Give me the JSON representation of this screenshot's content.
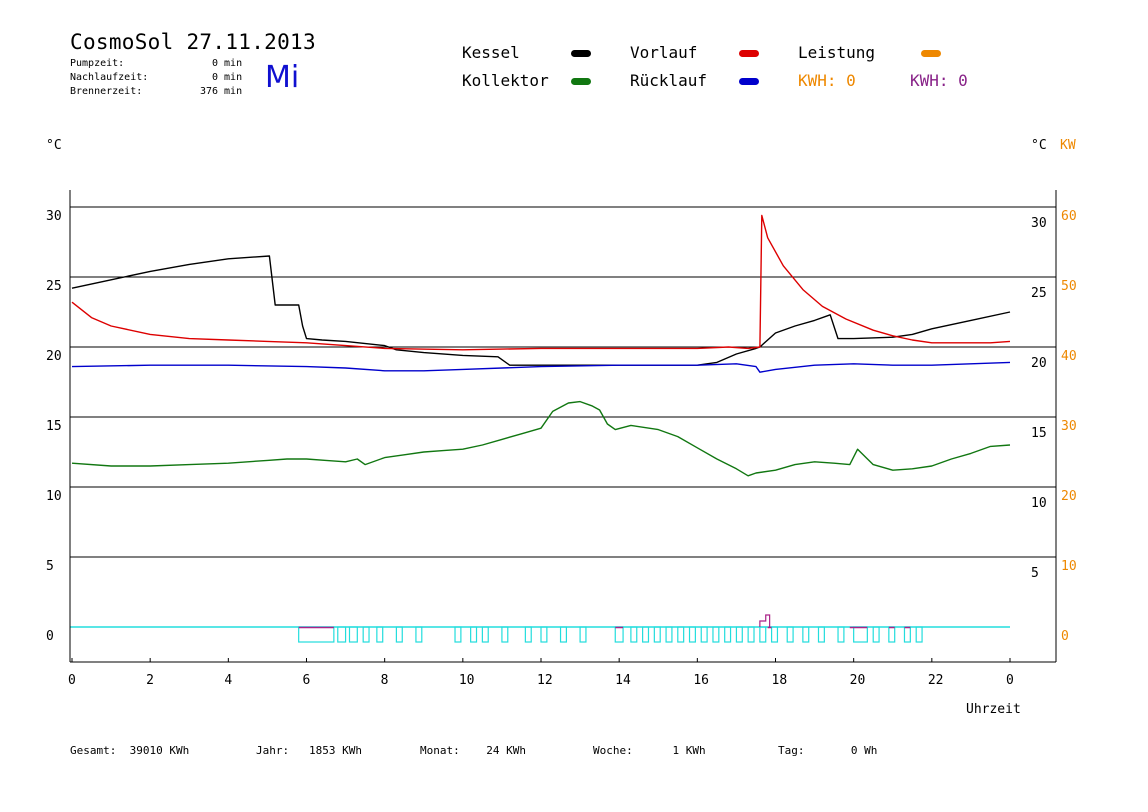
{
  "header": {
    "title": "CosmoSol 27.11.2013",
    "weekday": "Mi",
    "stats": [
      {
        "label": "Pumpzeit:",
        "value": "0",
        "unit": "min"
      },
      {
        "label": "Nachlaufzeit:",
        "value": "0",
        "unit": "min"
      },
      {
        "label": "Brennerzeit:",
        "value": "376",
        "unit": "min"
      }
    ]
  },
  "legend": {
    "kessel": "Kessel",
    "kollektor": "Kollektor",
    "vorlauf": "Vorlauf",
    "ruecklauf": "Rücklauf",
    "leistung": "Leistung",
    "kwh_orange": "KWH: 0",
    "kwh_purple": "KWH: 0"
  },
  "axes": {
    "left_unit": "°C",
    "right_unit": "°C",
    "right_unit2": "KW",
    "x_label": "Uhrzeit"
  },
  "colors": {
    "kessel": "#000000",
    "vorlauf": "#dd0000",
    "ruecklauf": "#0000cc",
    "kollektor": "#117711",
    "leistung": "#ee8800",
    "kwh_purple": "#882288",
    "pump": "#22dddd",
    "brenner": "#aa2288",
    "grid": "#000000"
  },
  "footer": [
    {
      "label": "Gesamt:",
      "value": "39010 KWh"
    },
    {
      "label": "Jahr:",
      "value": "1853 KWh"
    },
    {
      "label": "Monat:",
      "value": "24 KWh"
    },
    {
      "label": "Woche:",
      "value": "1 KWh"
    },
    {
      "label": "Tag:",
      "value": "0 Wh"
    }
  ],
  "chart_data": {
    "type": "line",
    "xlabel": "Uhrzeit",
    "x_ticks": [
      "0",
      "2",
      "4",
      "6",
      "8",
      "10",
      "12",
      "14",
      "16",
      "18",
      "20",
      "22",
      "0"
    ],
    "xlim": [
      0,
      24
    ],
    "ylim": [
      -2.5,
      32
    ],
    "y_left_ticks": [
      0,
      5,
      10,
      15,
      20,
      25,
      30
    ],
    "y_right_ticks": [
      5,
      10,
      15,
      20,
      25,
      30
    ],
    "y_kw_ticks": [
      0,
      10,
      20,
      30,
      40,
      50,
      60
    ],
    "grid": "horizontal lines at 5, 10, 15, 20, 25, 30 °C",
    "series": [
      {
        "name": "Kessel",
        "key": "kessel",
        "x": [
          0,
          1,
          2,
          3,
          4,
          5.05,
          5.2,
          5.8,
          5.9,
          6.0,
          6.4,
          7.0,
          8.0,
          8.3,
          9.0,
          10.0,
          10.9,
          11.2,
          12.0,
          14.0,
          16.0,
          16.5,
          17.0,
          17.5,
          17.6,
          18.0,
          18.5,
          19.0,
          19.4,
          19.6,
          20.0,
          21.0,
          21.5,
          22.0,
          23.0,
          24.0
        ],
        "y": [
          24.2,
          24.8,
          25.4,
          25.9,
          26.3,
          26.5,
          23.0,
          23.0,
          21.5,
          20.6,
          20.5,
          20.4,
          20.1,
          19.8,
          19.6,
          19.4,
          19.3,
          18.7,
          18.7,
          18.7,
          18.7,
          18.9,
          19.5,
          19.9,
          20.0,
          21.0,
          21.5,
          21.9,
          22.3,
          20.6,
          20.6,
          20.7,
          20.9,
          21.3,
          21.9,
          22.5
        ]
      },
      {
        "name": "Vorlauf",
        "key": "vorlauf",
        "x": [
          0,
          0.5,
          1,
          2,
          3,
          4,
          5,
          6,
          7,
          8,
          10,
          12,
          14,
          16,
          16.8,
          17.3,
          17.6,
          17.65,
          17.8,
          18.2,
          18.7,
          19.2,
          19.8,
          20.5,
          21.0,
          21.5,
          22.0,
          23.0,
          23.5,
          24.0
        ],
        "y": [
          23.2,
          22.1,
          21.5,
          20.9,
          20.6,
          20.5,
          20.4,
          20.3,
          20.1,
          19.9,
          19.8,
          19.9,
          19.9,
          19.9,
          20.0,
          19.9,
          20.0,
          29.4,
          27.8,
          25.8,
          24.1,
          22.9,
          22.0,
          21.2,
          20.8,
          20.5,
          20.3,
          20.3,
          20.3,
          20.4
        ]
      },
      {
        "name": "Rücklauf",
        "key": "ruecklauf",
        "x": [
          0,
          2,
          4,
          6,
          7,
          8,
          9,
          10,
          12,
          14,
          16,
          17,
          17.5,
          17.6,
          18,
          19,
          20,
          21,
          22,
          23,
          24
        ],
        "y": [
          18.6,
          18.7,
          18.7,
          18.6,
          18.5,
          18.3,
          18.3,
          18.4,
          18.6,
          18.7,
          18.7,
          18.8,
          18.6,
          18.2,
          18.4,
          18.7,
          18.8,
          18.7,
          18.7,
          18.8,
          18.9
        ]
      },
      {
        "name": "Kollektor",
        "key": "kollektor",
        "x": [
          0,
          1,
          2,
          3,
          4,
          5,
          5.5,
          6,
          6.5,
          7,
          7.3,
          7.5,
          8,
          8.5,
          9,
          9.5,
          10,
          10.5,
          11,
          11.5,
          12,
          12.3,
          12.7,
          13.0,
          13.3,
          13.5,
          13.7,
          13.9,
          14.3,
          15,
          15.5,
          16,
          16.5,
          17,
          17.3,
          17.5,
          18,
          18.5,
          19,
          19.5,
          19.9,
          20.1,
          20.5,
          21,
          21.5,
          22,
          22.5,
          23,
          23.5,
          24
        ],
        "y": [
          11.7,
          11.5,
          11.5,
          11.6,
          11.7,
          11.9,
          12.0,
          12.0,
          11.9,
          11.8,
          12.0,
          11.6,
          12.1,
          12.3,
          12.5,
          12.6,
          12.7,
          13.0,
          13.4,
          13.8,
          14.2,
          15.4,
          16.0,
          16.1,
          15.8,
          15.5,
          14.5,
          14.1,
          14.4,
          14.1,
          13.6,
          12.8,
          12.0,
          11.3,
          10.8,
          11.0,
          11.2,
          11.6,
          11.8,
          11.7,
          11.6,
          12.7,
          11.6,
          11.2,
          11.3,
          11.5,
          12.0,
          12.4,
          12.9,
          13.0
        ]
      }
    ],
    "pump_pulses_hours": [
      [
        5.8,
        6.7
      ],
      [
        6.8,
        7.0
      ],
      [
        7.1,
        7.3
      ],
      [
        7.45,
        7.6
      ],
      [
        7.8,
        7.95
      ],
      [
        8.3,
        8.45
      ],
      [
        8.8,
        8.95
      ],
      [
        9.8,
        9.95
      ],
      [
        10.2,
        10.35
      ],
      [
        10.5,
        10.65
      ],
      [
        11.0,
        11.15
      ],
      [
        11.6,
        11.75
      ],
      [
        12.0,
        12.15
      ],
      [
        12.5,
        12.65
      ],
      [
        13.0,
        13.15
      ],
      [
        13.9,
        14.1
      ],
      [
        14.3,
        14.45
      ],
      [
        14.6,
        14.75
      ],
      [
        14.9,
        15.05
      ],
      [
        15.2,
        15.35
      ],
      [
        15.5,
        15.65
      ],
      [
        15.8,
        15.95
      ],
      [
        16.1,
        16.25
      ],
      [
        16.4,
        16.55
      ],
      [
        16.7,
        16.85
      ],
      [
        17.0,
        17.15
      ],
      [
        17.3,
        17.45
      ],
      [
        17.6,
        17.75
      ],
      [
        17.9,
        18.05
      ],
      [
        18.3,
        18.45
      ],
      [
        18.7,
        18.85
      ],
      [
        19.1,
        19.25
      ],
      [
        19.6,
        19.75
      ],
      [
        20.0,
        20.35
      ],
      [
        20.5,
        20.65
      ],
      [
        20.9,
        21.05
      ],
      [
        21.3,
        21.45
      ],
      [
        21.6,
        21.75
      ]
    ],
    "brenner_on_hours": [
      [
        5.8,
        6.7
      ],
      [
        13.9,
        14.1
      ],
      [
        17.8,
        17.9
      ],
      [
        19.9,
        20.35
      ],
      [
        20.9,
        21.05
      ],
      [
        21.3,
        21.45
      ]
    ]
  }
}
